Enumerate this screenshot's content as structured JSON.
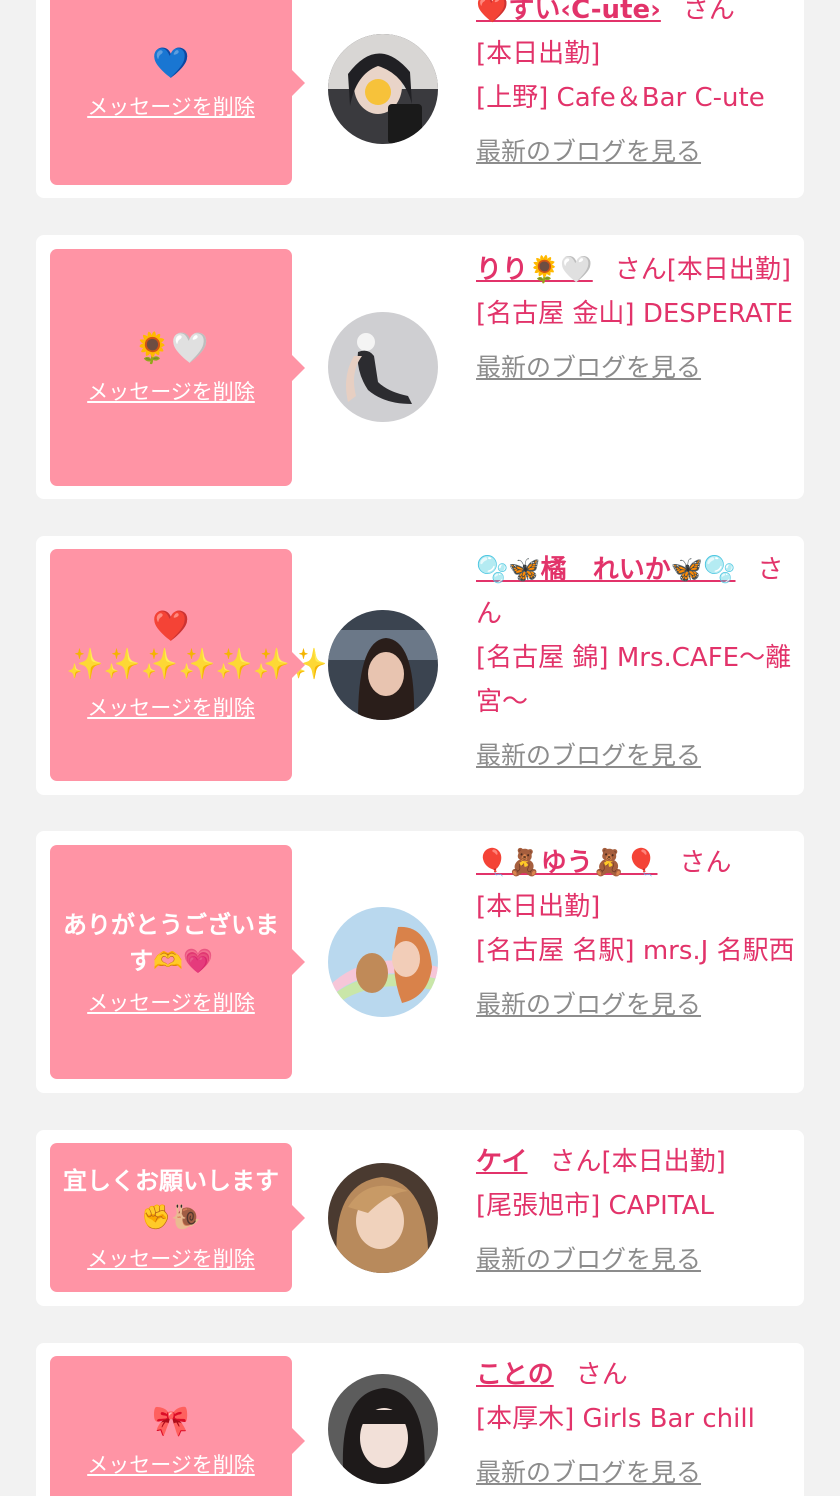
{
  "cards": [
    {
      "message": "💙",
      "delete_label": "メッセージを削除",
      "name": "❤️すい‹C-ute›",
      "honorific": "さん",
      "status": "[本日出勤]",
      "shop": "[上野] Cafe＆Bar C-ute",
      "blog_label": "最新のブログを見る"
    },
    {
      "message": "🌻🤍",
      "delete_label": "メッセージを削除",
      "name": "りり🌻🤍",
      "honorific": "さん",
      "status": "[本日出勤]",
      "shop": "[名古屋 金山] DESPERATE",
      "blog_label": "最新のブログを見る"
    },
    {
      "message": "❤️✨✨✨✨✨✨✨✨✨✨",
      "delete_label": "メッセージを削除",
      "name": "🫧🦋橘　れいか🦋🫧",
      "honorific": "さん",
      "status": "",
      "shop": "[名古屋 錦] Mrs.CAFE〜離宮〜",
      "blog_label": "最新のブログを見る"
    },
    {
      "message": "ありがとうございます🫶💗",
      "delete_label": "メッセージを削除",
      "name": "🎈🧸ゆう🧸🎈",
      "honorific": "さん",
      "status": "[本日出勤]",
      "shop": "[名古屋 名駅] mrs.J 名駅西",
      "blog_label": "最新のブログを見る"
    },
    {
      "message": "宜しくお願いします✊🐌",
      "delete_label": "メッセージを削除",
      "name": "ケイ",
      "honorific": "さん",
      "status": "[本日出勤]",
      "shop": "[尾張旭市] CAPITAL",
      "blog_label": "最新のブログを見る"
    },
    {
      "message": "🎀",
      "delete_label": "メッセージを削除",
      "name": "ことの",
      "honorific": "さん",
      "status": "",
      "shop": "[本厚木] Girls Bar chill",
      "blog_label": "最新のブログを見る"
    }
  ],
  "colors": {
    "background": "#f2f2f2",
    "bubble": "#ff94a5",
    "accent": "#e2336a",
    "muted_link": "#8c8c8c"
  }
}
